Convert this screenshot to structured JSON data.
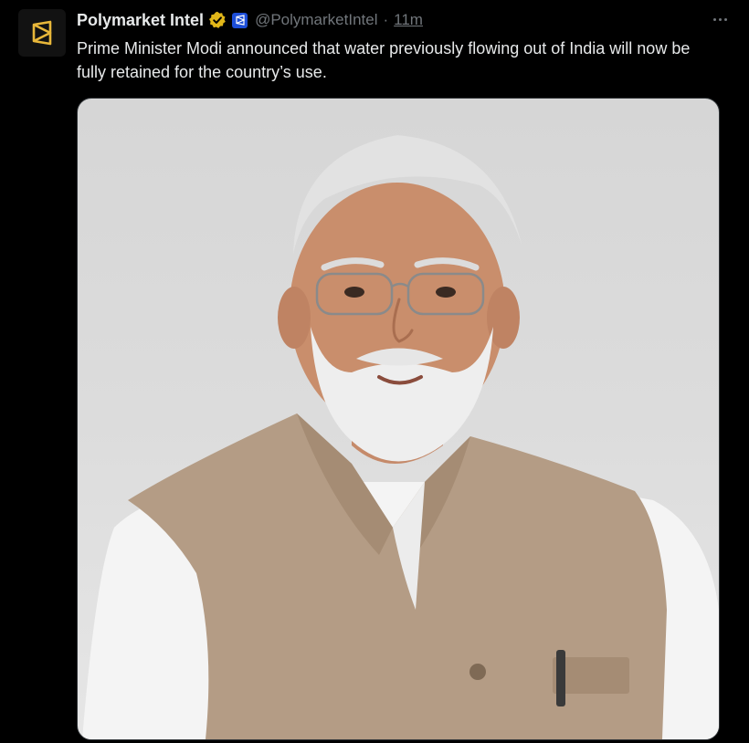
{
  "tweet": {
    "author_name": "Polymarket Intel",
    "handle": "@PolymarketIntel",
    "separator": "·",
    "time": "11m",
    "text": "Prime Minister Modi announced that water previously flowing out of India will now be fully retained for the country’s use.",
    "icons": {
      "avatar": "polymarket-logo-icon",
      "verified": "verified-badge-icon",
      "affiliate": "affiliate-badge-icon",
      "more": "more-options-icon"
    },
    "media": {
      "type": "photo",
      "subject": "portrait"
    }
  },
  "colors": {
    "background": "#000000",
    "text_primary": "#e7e9ea",
    "text_secondary": "#71767b",
    "verified_gold": "#e2b719",
    "affiliate_blue": "#1d4ed8",
    "logo_yellow": "#e8b73a"
  }
}
